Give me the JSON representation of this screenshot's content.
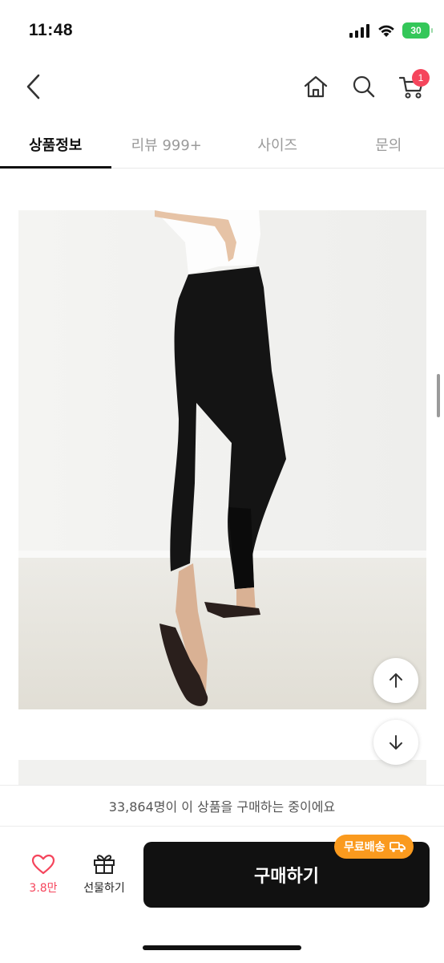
{
  "status_bar": {
    "time": "11:48",
    "battery": "30"
  },
  "header": {
    "cart_count": "1"
  },
  "tabs": [
    {
      "label": "상품정보",
      "active": true
    },
    {
      "label": "리뷰 999+",
      "active": false
    },
    {
      "label": "사이즈",
      "active": false
    },
    {
      "label": "문의",
      "active": false
    }
  ],
  "buyers_notice": "33,864명이 이 상품을 구매하는 중이에요",
  "actions": {
    "like_count": "3.8만",
    "gift_label": "선물하기",
    "buy_label": "구매하기",
    "free_shipping_badge": "무료배송"
  },
  "colors": {
    "accent": "#f5455c",
    "badge_orange": "#fa9a1e",
    "buy_button": "#111111"
  }
}
